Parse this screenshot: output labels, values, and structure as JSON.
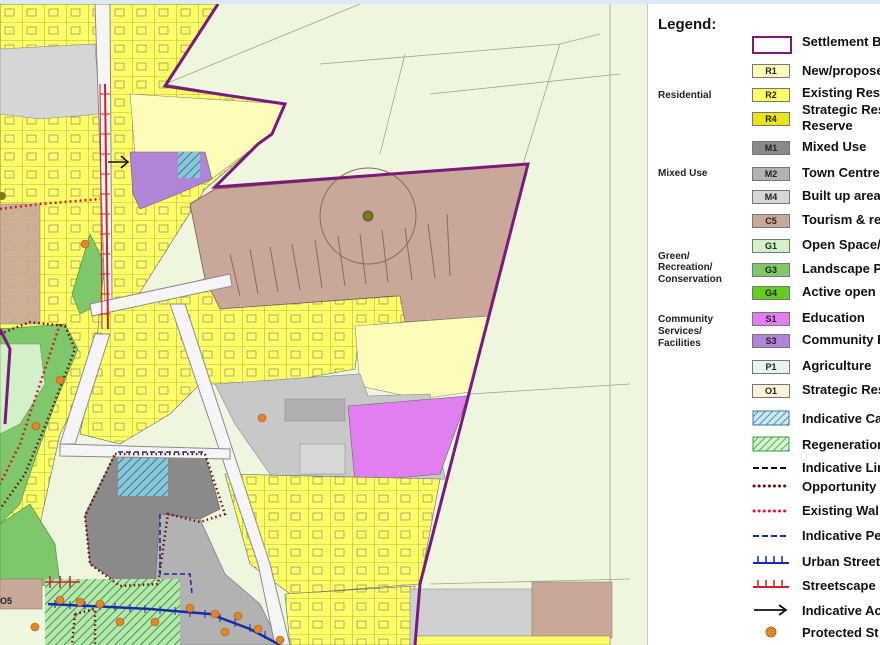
{
  "legend": {
    "title": "Legend:",
    "groups": {
      "residential": "Residential",
      "mixed_use": "Mixed Use",
      "green_line1": "Green/",
      "green_line2": "Recreation/",
      "green_line3": "Conservation",
      "community_line1": "Community",
      "community_line2": "Services/",
      "community_line3": "Facilities"
    },
    "items": {
      "settlement": {
        "label": "Settlement B"
      },
      "r1": {
        "code": "R1",
        "label": "New/propose",
        "color": "#fffbb8"
      },
      "r2": {
        "code": "R2",
        "label": "Existing Res",
        "color": "#ffff66"
      },
      "r4": {
        "code": "R4",
        "label_line1": "Strategic Res",
        "label_line2": "Reserve",
        "color": "#e6e619"
      },
      "m1": {
        "code": "M1",
        "label": "Mixed Use",
        "color": "#8a8a8a"
      },
      "m2": {
        "code": "M2",
        "label": "Town Centre",
        "color": "#b2b2b2"
      },
      "m4": {
        "code": "M4",
        "label": "Built up area",
        "color": "#d6d6d6"
      },
      "c5": {
        "code": "C5",
        "label": "Tourism & re",
        "color": "#c9a89a"
      },
      "g1": {
        "code": "G1",
        "label": "Open Space/",
        "color": "#d3f0c8"
      },
      "g3": {
        "code": "G3",
        "label": "Landscape P",
        "color": "#7ec76a"
      },
      "g4": {
        "code": "G4",
        "label": "Active open",
        "color": "#66cc1f"
      },
      "s1": {
        "code": "S1",
        "label": "Education",
        "color": "#e27ff0"
      },
      "s3": {
        "code": "S3",
        "label": "Community F",
        "color": "#b084d6"
      },
      "p1": {
        "code": "P1",
        "label": "Agriculture",
        "color": "#e3f5ee"
      },
      "o1": {
        "code": "O1",
        "label": "Strategic Res",
        "color": "#fbf1d6"
      },
      "cross_hatch": {
        "label": "Indicative Ca"
      },
      "regen": {
        "label": "Regeneration"
      },
      "dash_black": {
        "label": "Indicative Lin"
      },
      "dot_brown": {
        "label": "Opportunity"
      },
      "dot_red": {
        "label": "Existing Wal"
      },
      "dash_blue": {
        "label": "Indicative Pe"
      },
      "urban_street": {
        "label": "Urban Street"
      },
      "streetscape": {
        "label": "Streetscape I"
      },
      "arrow": {
        "label": "Indicative Ac"
      },
      "protected": {
        "label": "Protected St"
      }
    }
  },
  "map": {
    "labels": {
      "o5": "O5"
    },
    "colors": {
      "agriculture": "#eef6e0",
      "residential": "#ffff66",
      "new_residential": "#fffbb8",
      "tourism": "#c9a89a",
      "education": "#e27ff0",
      "community": "#b084d6",
      "mixed_use": "#8a8a8a",
      "town_centre": "#b2b2b2",
      "green": "#7ec76a",
      "boundary": "#7a1a7a"
    }
  }
}
